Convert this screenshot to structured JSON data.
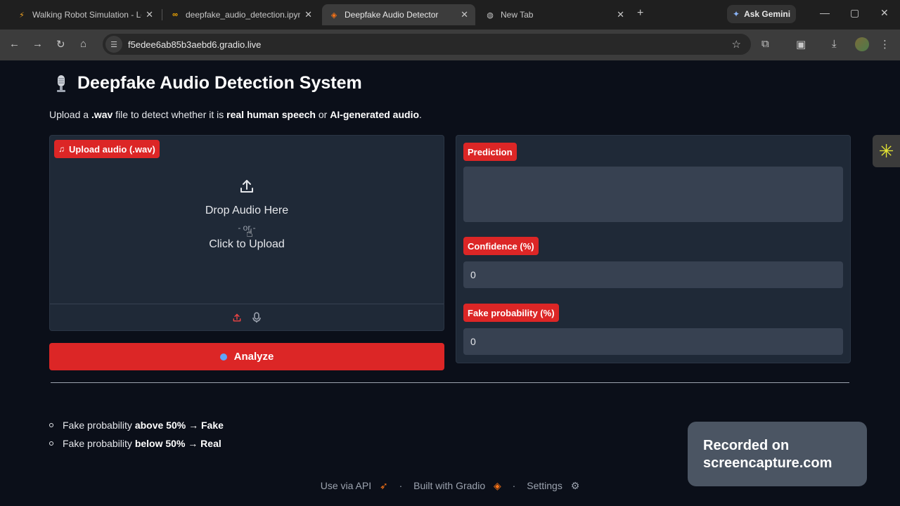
{
  "browser": {
    "tabs": [
      {
        "title": "Walking Robot Simulation - Lee",
        "icon": "bolt-icon",
        "active": false
      },
      {
        "title": "deepfake_audio_detection.ipynb",
        "icon": "colab-icon",
        "active": false
      },
      {
        "title": "Deepfake Audio Detector",
        "icon": "gradio-icon",
        "active": true
      },
      {
        "title": "New Tab",
        "icon": "chrome-icon",
        "active": false
      }
    ],
    "ask_gemini": "Ask Gemini",
    "url": "f5edee6ab85b3aebd6.gradio.live"
  },
  "app": {
    "title": "Deepfake Audio Detection System",
    "description": {
      "p1": "Upload a ",
      "b1": ".wav",
      "p2": " file to detect whether it is ",
      "b2": "real human speech",
      "p3": " or ",
      "b3": "AI-generated audio",
      "p4": "."
    },
    "upload": {
      "label": "Upload audio (.wav)",
      "drop_text": "Drop Audio Here",
      "or_text": "- or -",
      "click_text": "Click to Upload"
    },
    "analyze_label": "Analyze",
    "outputs": {
      "prediction_label": "Prediction",
      "prediction_value": "",
      "confidence_label": "Confidence (%)",
      "confidence_value": "0",
      "fake_prob_label": "Fake probability (%)",
      "fake_prob_value": "0"
    },
    "rules": [
      {
        "prefix": "Fake probability",
        "bold": "above 50% → Fake"
      },
      {
        "prefix": "Fake probability",
        "bold": "below 50% → Real"
      }
    ],
    "footer": {
      "api": "Use via API",
      "built": "Built with Gradio",
      "settings": "Settings",
      "sep": "·"
    }
  },
  "watermark": {
    "line1": "Recorded on",
    "line2": "screencapture.com"
  },
  "colors": {
    "accent": "#dc2626",
    "panel": "#1f2937",
    "background": "#0b0f19"
  }
}
